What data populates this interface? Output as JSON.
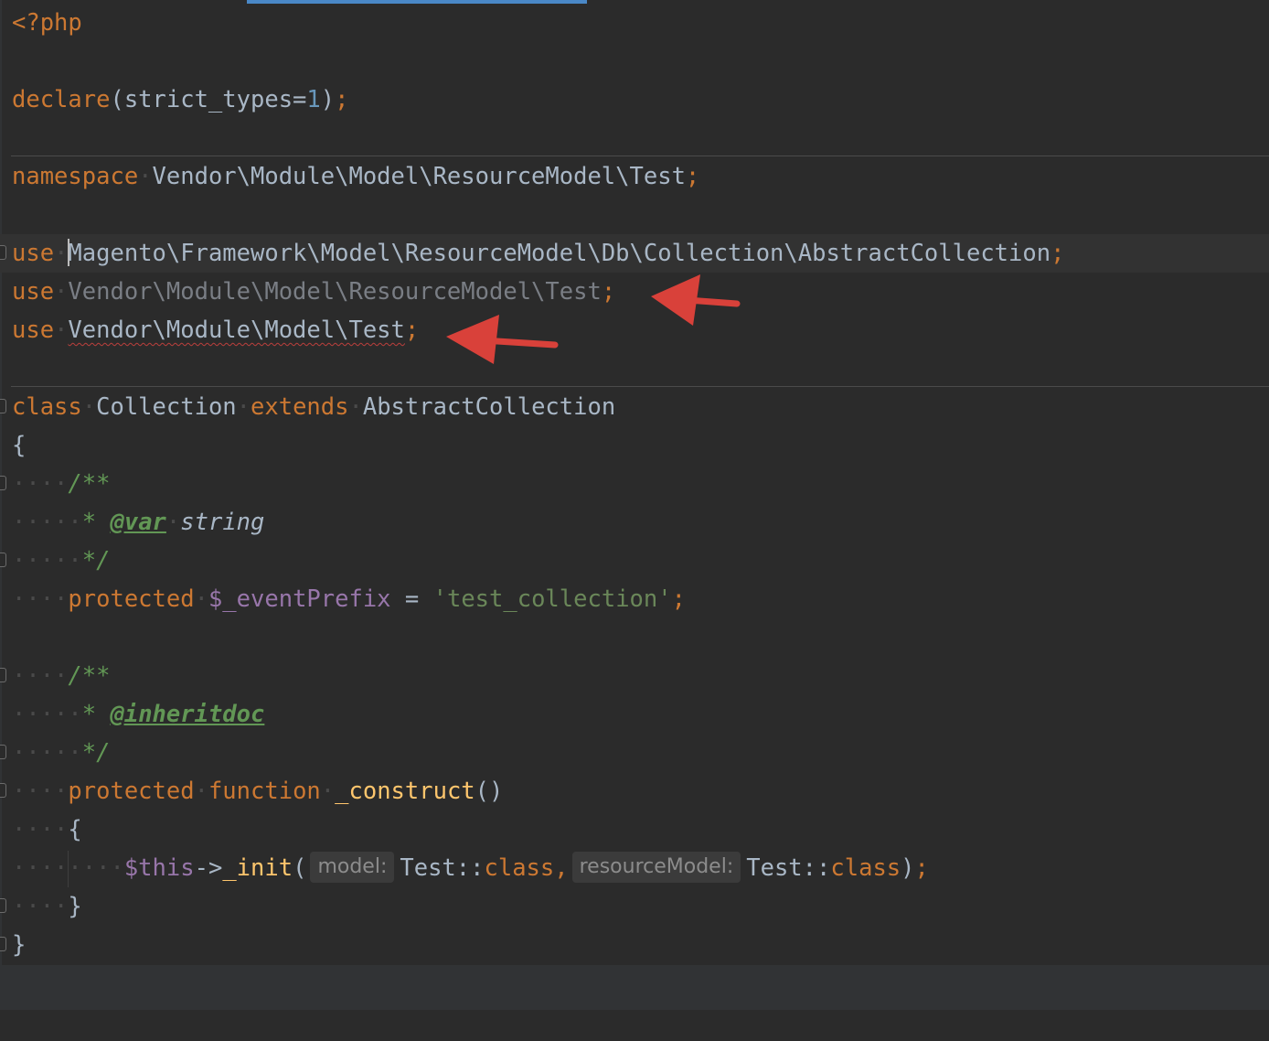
{
  "editor": {
    "line1": {
      "open_tag": "<?php"
    },
    "line2": {
      "declare": "declare",
      "open": "(strict_types=",
      "value": "1",
      "close": ")",
      "semi": ";"
    },
    "line3": {
      "keyword": "namespace",
      "name": "Vendor\\Module\\Model\\ResourceModel\\Test",
      "semi": ";"
    },
    "line4": {
      "keyword": "use",
      "name_rest": "agento\\Framework\\Model\\ResourceModel\\Db\\Collection\\AbstractCollection",
      "first_char": "M",
      "semi": ";"
    },
    "line5": {
      "keyword": "use",
      "name": "Vendor\\Module\\Model\\ResourceModel\\Test",
      "semi": ";"
    },
    "line6": {
      "keyword": "use",
      "name": "Vendor\\Module\\Model\\Test",
      "semi": ";"
    },
    "line7": {
      "keyword": "class",
      "name": "Collection",
      "extends": "extends",
      "parent": "AbstractCollection"
    },
    "line8": {
      "brace": "{"
    },
    "line9": {
      "doc_open": "/**"
    },
    "line10": {
      "star": "* ",
      "tag": "@var",
      "type": "string"
    },
    "line11": {
      "doc_close": "*/"
    },
    "line12": {
      "keyword": "protected",
      "variable": "$_eventPrefix",
      "assign": " = ",
      "string": "'test_collection'",
      "semi": ";"
    },
    "line13": {
      "doc_open": "/**"
    },
    "line14": {
      "star": "* ",
      "tag": "@inheritdoc"
    },
    "line15": {
      "doc_close": "*/"
    },
    "line16": {
      "keyword": "protected",
      "keyword2": "function",
      "fn_name": "_construct",
      "parens": "()"
    },
    "line17": {
      "brace": "{"
    },
    "line18": {
      "this": "$this",
      "arrow": "->",
      "method": "_init",
      "open": "(",
      "hint1": "model:",
      "cls1": "Test",
      "dc1": "::",
      "kw1": "class",
      "comma": ",",
      "hint2": "resourceModel:",
      "cls2": "Test",
      "dc2": "::",
      "kw2": "class",
      "close": ")",
      "semi": ";"
    },
    "line19": {
      "brace": "}"
    },
    "line20": {
      "brace": "}"
    }
  },
  "colors": {
    "background": "#2b2b2b",
    "keyword": "#cc7832",
    "text": "#a9b7c6",
    "unused_import": "#7a7e85",
    "variable": "#9876aa",
    "string": "#6a8759",
    "doc_comment": "#629755",
    "function": "#ffc66d",
    "number": "#6897bb",
    "annotation_arrow": "#d9413a"
  }
}
